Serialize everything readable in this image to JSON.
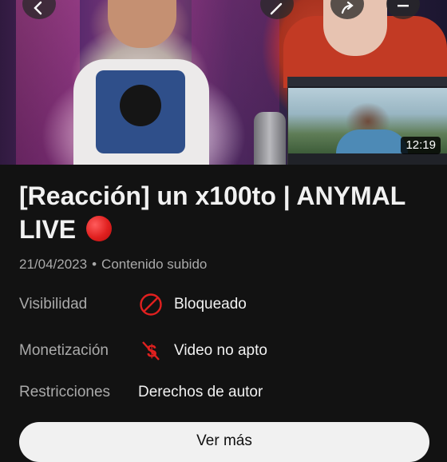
{
  "video": {
    "duration": "12:19",
    "title": "[Reacción] un x100to | ANYMAL LIVE",
    "title_emoji": "red-circle",
    "date": "21/04/2023",
    "separator": "•",
    "content_status": "Contenido subido"
  },
  "details": [
    {
      "label": "Visibilidad",
      "icon": "blocked-icon",
      "value": "Bloqueado"
    },
    {
      "label": "Monetización",
      "icon": "no-money-icon",
      "value": "Video no apto"
    },
    {
      "label": "Restricciones",
      "icon": "",
      "value": "Derechos de autor"
    }
  ],
  "actions": {
    "more_label": "Ver más"
  },
  "colors": {
    "background": "#121212",
    "accent_red": "#e0201f",
    "muted_text": "#aaaaaa",
    "button_bg": "#f1f1f1"
  },
  "top_buttons": [
    "back-icon",
    "edit-icon",
    "share-icon",
    "more-icon"
  ]
}
